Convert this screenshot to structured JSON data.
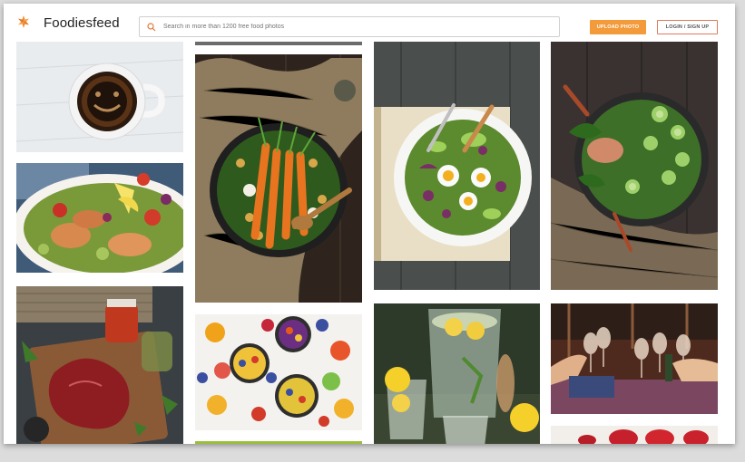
{
  "brand": {
    "name": "Foodiesfeed",
    "logo_icon": "orange-flower-logo-icon"
  },
  "search": {
    "placeholder": "Search in more than 1200 free food photos",
    "icon": "search-icon"
  },
  "actions": {
    "upload_label": "UPLOAD PHOTO",
    "login_label": "LOGIN / SIGN UP"
  },
  "colors": {
    "accent": "#f39a3a",
    "login_border": "#e07a5a",
    "background": "#ffffff"
  },
  "gallery": {
    "photos": [
      {
        "name": "photo-coffee-cup"
      },
      {
        "name": "photo-salmon-salad"
      },
      {
        "name": "photo-raw-beef-steak"
      },
      {
        "name": "photo-roasted-carrots-bowl"
      },
      {
        "name": "photo-fruit-bowls"
      },
      {
        "name": "photo-egg-salad-bowl"
      },
      {
        "name": "photo-lemon-drinks"
      },
      {
        "name": "photo-green-salad-bowl"
      },
      {
        "name": "photo-wine-toast"
      },
      {
        "name": "photo-strawberries"
      }
    ]
  }
}
